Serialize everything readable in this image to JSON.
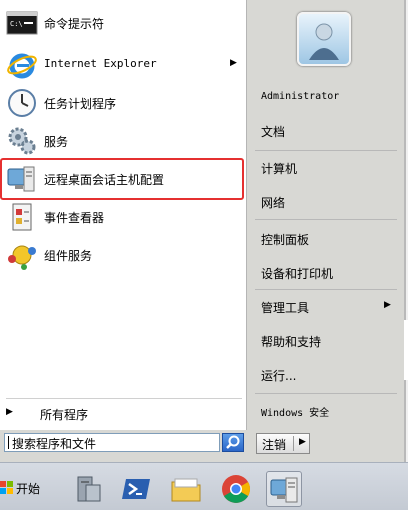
{
  "start_menu": {
    "programs": [
      {
        "label": "命令提示符",
        "icon": "cmd-icon"
      },
      {
        "label": "Internet Explorer",
        "icon": "ie-icon",
        "has_submenu": true
      },
      {
        "label": "任务计划程序",
        "icon": "task-scheduler-icon"
      },
      {
        "label": "服务",
        "icon": "services-icon"
      },
      {
        "label": "远程桌面会话主机配置",
        "icon": "remote-desktop-config-icon",
        "highlighted": true
      },
      {
        "label": "事件查看器",
        "icon": "event-viewer-icon"
      },
      {
        "label": "组件服务",
        "icon": "component-services-icon"
      }
    ],
    "all_programs": "所有程序",
    "search": {
      "placeholder": "搜索程序和文件"
    },
    "right": {
      "user": "Administrator",
      "items": [
        "文档",
        "计算机",
        "网络",
        "控制面板",
        "设备和打印机",
        "管理工具",
        "帮助和支持",
        "运行...",
        "Windows 安全"
      ]
    },
    "shutdown": {
      "label": "注销"
    }
  },
  "taskbar": {
    "start_label": "开始",
    "items": [
      "server-manager-icon",
      "powershell-icon",
      "explorer-icon",
      "chrome-icon",
      "remote-desktop-config-icon"
    ]
  },
  "colors": {
    "highlight_border": "#e53030"
  }
}
